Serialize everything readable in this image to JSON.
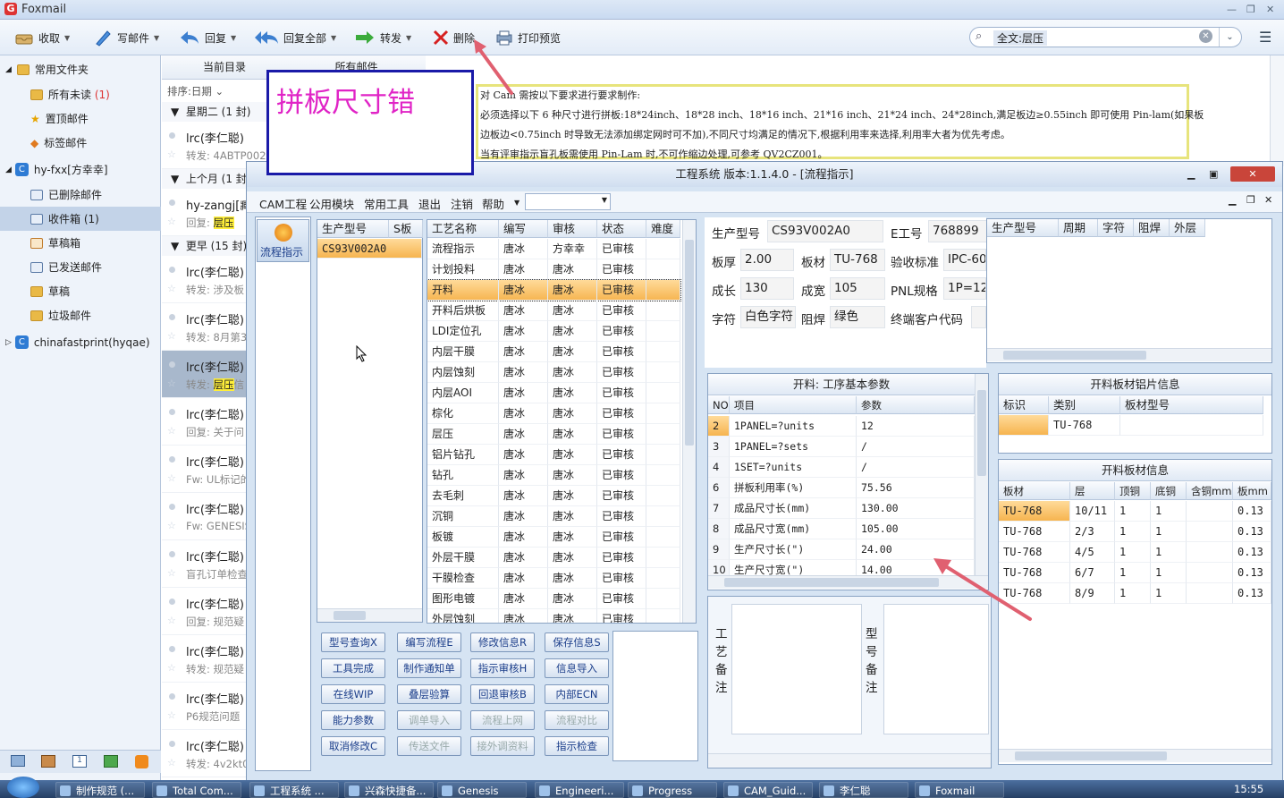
{
  "foxmail": {
    "app_title": "Foxmail",
    "toolbar": {
      "receive": "收取",
      "compose": "写邮件",
      "reply": "回复",
      "reply_all": "回复全部",
      "forward": "转发",
      "delete": "删除",
      "print_preview": "打印预览"
    },
    "search": {
      "tag": "全文:层压"
    },
    "sidebar": {
      "common_folder": "常用文件夹",
      "unread": "所有未读",
      "unread_count": "(1)",
      "starred": "置顶邮件",
      "tagged": "标签邮件",
      "account1": "hy-fxx[方幸幸]",
      "deleted": "已删除邮件",
      "inbox": "收件箱",
      "inbox_count": "(1)",
      "drafts": "草稿箱",
      "sent": "已发送邮件",
      "draft2": "草稿",
      "junk": "垃圾邮件",
      "account2": "chinafastprint(hyqae)"
    },
    "list": {
      "tab_current": "当前目录",
      "tab_all": "所有邮件",
      "sort": "排序:日期",
      "group_tue": "星期二 (1 封)",
      "group_lastmonth": "上个月 (1 封)",
      "group_older": "更早 (15 封)",
      "mails": [
        {
          "from": "lrc(李仁聪)",
          "subject": "转发: 4ABTP002"
        },
        {
          "from": "hy-zangj[臧",
          "subject_pre": "回复: ",
          "subject_hl": "层压"
        },
        {
          "from": "lrc(李仁聪)",
          "subject": "转发: 涉及板"
        },
        {
          "from": "lrc(李仁聪)",
          "subject": "转发: 8月第3"
        },
        {
          "from": "lrc(李仁聪)",
          "subject_pre": "转发: ",
          "subject_hl": "层压",
          "subject_post": "信"
        },
        {
          "from": "lrc(李仁聪)",
          "subject": "回复: 关于问"
        },
        {
          "from": "lrc(李仁聪)",
          "subject": "Fw: UL标记的"
        },
        {
          "from": "lrc(李仁聪)",
          "subject": "Fw: GENESIS"
        },
        {
          "from": "lrc(李仁聪)",
          "subject": "盲孔订单检查"
        },
        {
          "from": "lrc(李仁聪)",
          "subject": "回复: 规范疑"
        },
        {
          "from": "lrc(李仁聪)",
          "subject": "转发: 规范疑"
        },
        {
          "from": "lrc(李仁聪)",
          "subject": "P6规范问题"
        },
        {
          "from": "lrc(李仁聪)",
          "subject": "转发: 4v2kt0"
        }
      ]
    },
    "preview": {
      "line1": "对 Cam 需按以下要求进行要求制作:",
      "line2": "必须选择以下 6 种尺寸进行拼板:18*24inch、18*28 inch、18*16 inch、21*16 inch、21*24 inch、24*28inch,满足板边≥0.55inch 即可使用 Pin-lam(如果板",
      "line3": "边板边<0.75inch 时导致无法添加绑定网时可不加),不同尺寸均满足的情况下,根据利用率来选择,利用率大者为优先考虑。",
      "line4": "当有评审指示盲孔板需使用 Pin-Lam 时,不可作缩边处理,可参考 QV2CZ001。"
    }
  },
  "annotation": "拼板尺寸错",
  "erp": {
    "title": "工程系统   版本:1.1.4.0 - [流程指示]",
    "menu": [
      "CAM工程",
      "公用模块",
      "常用工具",
      "退出",
      "注销",
      "帮助"
    ],
    "side_button": "流程指示",
    "part_grid": {
      "headers": [
        "生产型号",
        "S板"
      ],
      "rows": [
        [
          "CS93V002A0",
          ""
        ]
      ]
    },
    "process_grid": {
      "headers": [
        "工艺名称",
        "编写",
        "审核",
        "状态",
        "难度"
      ],
      "rows": [
        [
          "流程指示",
          "唐冰",
          "方幸幸",
          "已审核"
        ],
        [
          "计划投料",
          "唐冰",
          "唐冰",
          "已审核"
        ],
        [
          "开料",
          "唐冰",
          "唐冰",
          "已审核"
        ],
        [
          "开料后烘板",
          "唐冰",
          "唐冰",
          "已审核"
        ],
        [
          "LDI定位孔",
          "唐冰",
          "唐冰",
          "已审核"
        ],
        [
          "内层干膜",
          "唐冰",
          "唐冰",
          "已审核"
        ],
        [
          "内层蚀刻",
          "唐冰",
          "唐冰",
          "已审核"
        ],
        [
          "内层AOI",
          "唐冰",
          "唐冰",
          "已审核"
        ],
        [
          "棕化",
          "唐冰",
          "唐冰",
          "已审核"
        ],
        [
          "层压",
          "唐冰",
          "唐冰",
          "已审核"
        ],
        [
          "铝片钻孔",
          "唐冰",
          "唐冰",
          "已审核"
        ],
        [
          "钻孔",
          "唐冰",
          "唐冰",
          "已审核"
        ],
        [
          "去毛刺",
          "唐冰",
          "唐冰",
          "已审核"
        ],
        [
          "沉铜",
          "唐冰",
          "唐冰",
          "已审核"
        ],
        [
          "板镀",
          "唐冰",
          "唐冰",
          "已审核"
        ],
        [
          "外层干膜",
          "唐冰",
          "唐冰",
          "已审核"
        ],
        [
          "干膜检查",
          "唐冰",
          "唐冰",
          "已审核"
        ],
        [
          "图形电镀",
          "唐冰",
          "唐冰",
          "已审核"
        ],
        [
          "外层蚀刻",
          "唐冰",
          "唐冰",
          "已审核"
        ]
      ],
      "selected_index": 2
    },
    "buttons": [
      [
        "型号查询X",
        "编写流程E",
        "修改信息R",
        "保存信息S"
      ],
      [
        "工具完成",
        "制作通知单",
        "指示审核H",
        "信息导入"
      ],
      [
        "在线WIP",
        "叠层验算",
        "回退审核B",
        "内部ECN"
      ],
      [
        "能力参数",
        "调单导入",
        "流程上网",
        "流程对比"
      ],
      [
        "取消修改C",
        "传送文件",
        "接外调资料",
        "指示检查"
      ]
    ],
    "info": {
      "part_no_label": "生产型号",
      "part_no": "CS93V002A0",
      "e_no_label": "E工号",
      "e_no": "768899",
      "thick_label": "板厚",
      "thick": "2.00",
      "material_label": "板材",
      "material": "TU-768",
      "std_label": "验收标准",
      "std": "IPC-60",
      "len_label": "成长",
      "len": "130",
      "wid_label": "成宽",
      "wid": "105",
      "pnl_label": "PNL规格",
      "pnl": "1P=12",
      "char_label": "字符",
      "char": "白色字符",
      "mask_label": "阻焊",
      "mask": "绿色",
      "cust_label": "终端客户代码",
      "cust": ""
    },
    "history_headers": [
      "生产型号",
      "周期",
      "字符",
      "阻焊",
      "外层"
    ],
    "param": {
      "title": "开料: 工序基本参数",
      "headers": [
        "NO",
        "项目",
        "参数"
      ],
      "rows": [
        [
          "2",
          "1PANEL=?units",
          "12"
        ],
        [
          "3",
          "1PANEL=?sets",
          "/"
        ],
        [
          "4",
          "1SET=?units",
          "/"
        ],
        [
          "6",
          "拼板利用率(%)",
          "75.56"
        ],
        [
          "7",
          "成品尺寸长(mm)",
          "130.00"
        ],
        [
          "8",
          "成品尺寸宽(mm)",
          "105.00"
        ],
        [
          "9",
          "生产尺寸长(\")",
          "24.00"
        ],
        [
          "10",
          "生产尺寸宽(\")",
          "14.00"
        ]
      ]
    },
    "alu": {
      "title": "开料板材铝片信息",
      "headers": [
        "标识",
        "类别",
        "板材型号"
      ],
      "rows": [
        [
          "",
          "TU-768",
          ""
        ]
      ]
    },
    "board": {
      "title": "开料板材信息",
      "headers": [
        "板材",
        "层",
        "顶铜",
        "底铜",
        "含铜mm",
        "板mm"
      ],
      "rows": [
        [
          "TU-768",
          "10/11",
          "1",
          "1",
          "",
          "0.13"
        ],
        [
          "TU-768",
          "2/3",
          "1",
          "1",
          "",
          "0.13"
        ],
        [
          "TU-768",
          "4/5",
          "1",
          "1",
          "",
          "0.13"
        ],
        [
          "TU-768",
          "6/7",
          "1",
          "1",
          "",
          "0.13"
        ],
        [
          "TU-768",
          "8/9",
          "1",
          "1",
          "",
          "0.13"
        ]
      ]
    },
    "remark1": "工艺备注",
    "remark2": "型号备注"
  },
  "taskbar": {
    "tasks": [
      "制作规范 (...",
      "Total Com...",
      "工程系统 ...",
      "兴森快捷备...",
      "Genesis",
      "Engineeri...",
      "Progress",
      "CAM_Guid...",
      "李仁聪",
      "Foxmail"
    ],
    "clock": "15:55"
  }
}
